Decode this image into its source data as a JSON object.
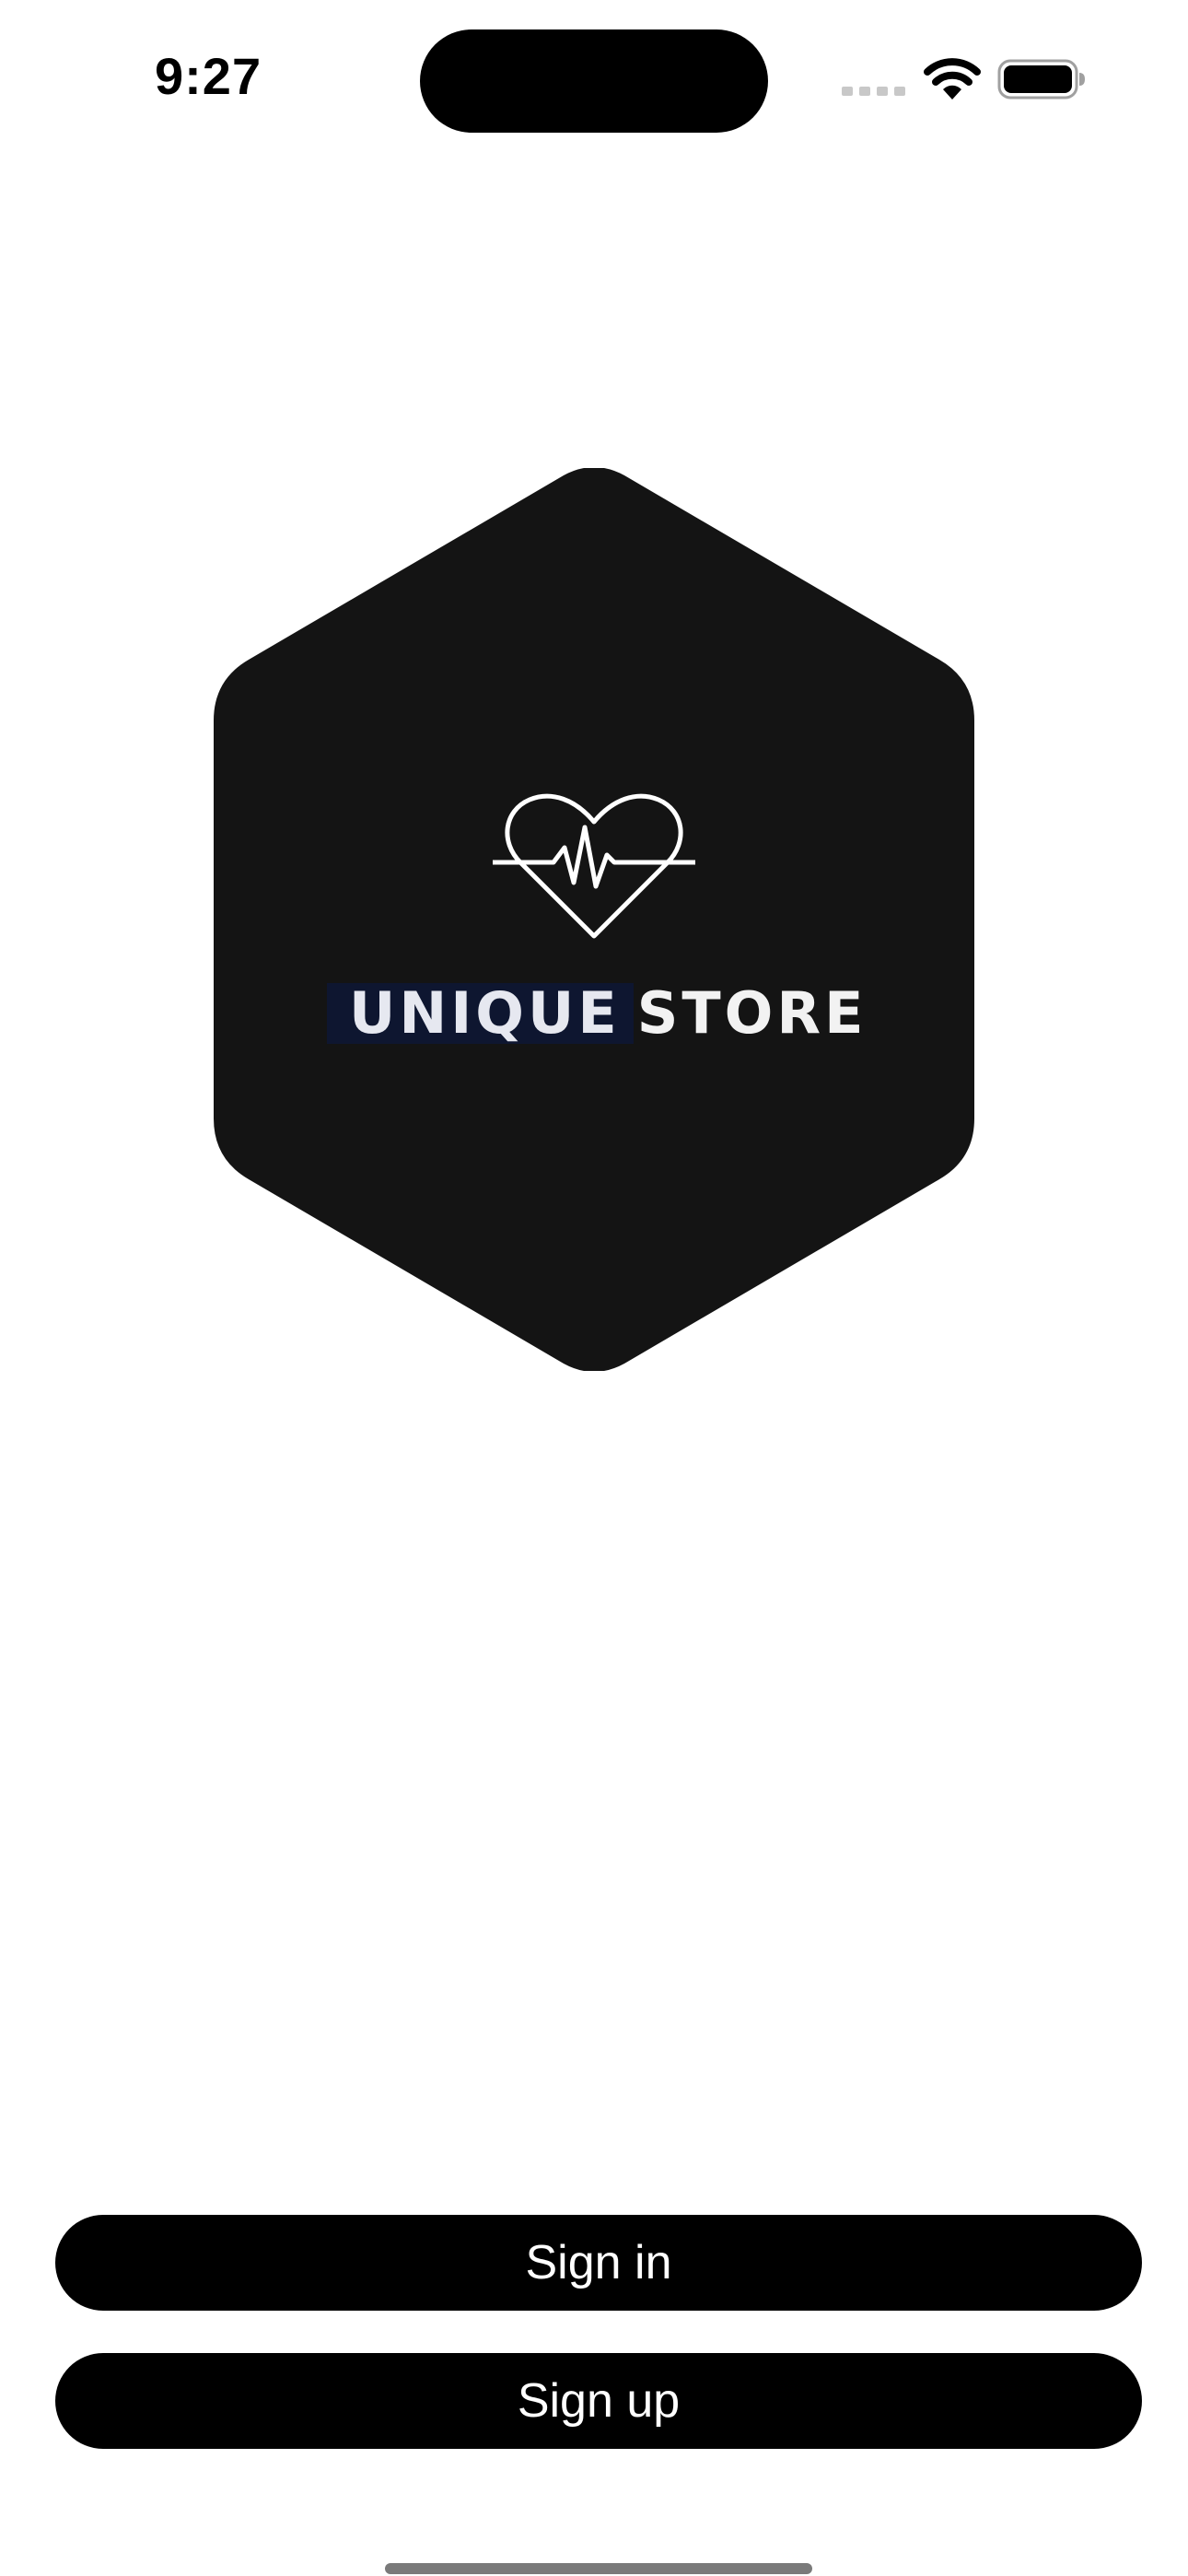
{
  "status_bar": {
    "time": "9:27",
    "icons": [
      "cellular-signal-icon",
      "wifi-icon",
      "battery-icon"
    ]
  },
  "logo": {
    "word_1": "UNIQUE",
    "word_2": "STORE",
    "icon": "heart-pulse-icon",
    "colors": {
      "background": "#141414",
      "word_1_highlight": "#0e1630",
      "line": "#ffffff"
    }
  },
  "actions": {
    "sign_in_label": "Sign in",
    "sign_up_label": "Sign up"
  },
  "colors": {
    "page_background": "#ffffff",
    "button_background": "#000000",
    "button_text": "#ffffff"
  }
}
